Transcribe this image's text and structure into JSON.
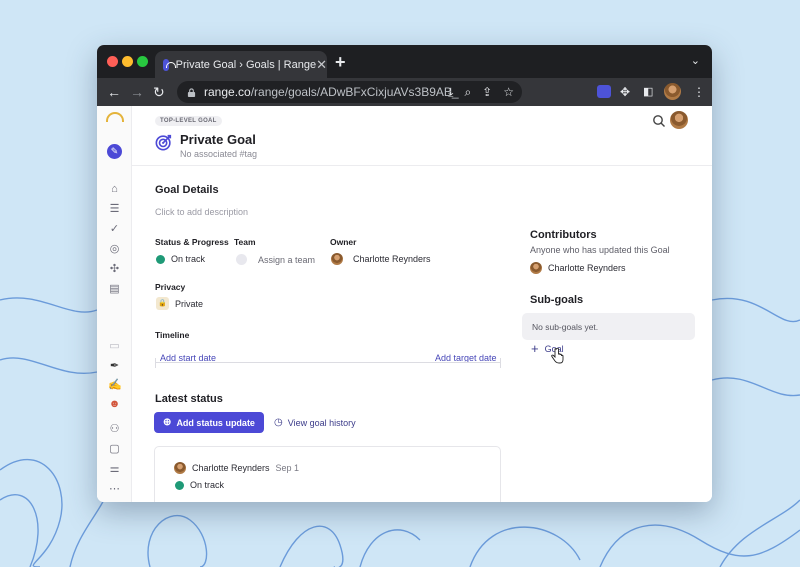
{
  "browser": {
    "tab_title": "Private Goal › Goals | Range",
    "tab_close": "✕",
    "new_tab": "+",
    "tabs_menu": "⌄",
    "url_host": "range.co",
    "url_path": "/range/goals/ADwBFxCixjuAVs3B9AB_",
    "back_icon": "←",
    "forward_icon": "→",
    "reload_icon": "↻"
  },
  "header": {
    "badge": "TOP-LEVEL GOAL",
    "title": "Private Goal",
    "tag": "No associated #tag"
  },
  "details": {
    "title": "Goal Details",
    "description_placeholder": "Click to add description",
    "status_label": "Status & Progress",
    "status_value": "On track",
    "team_label": "Team",
    "team_value": "Assign a team",
    "owner_label": "Owner",
    "owner_value": "Charlotte Reynders",
    "privacy_label": "Privacy",
    "privacy_value": "Private",
    "timeline_label": "Timeline",
    "start_date": "Add start date",
    "target_date": "Add target date"
  },
  "latest_status": {
    "title": "Latest status",
    "add_button": "Add status update",
    "history_link": "View goal history",
    "card_author": "Charlotte Reynders",
    "card_date": "Sep 1",
    "card_status": "On track"
  },
  "contributors": {
    "title": "Contributors",
    "subtitle": "Anyone who has updated this Goal",
    "person": "Charlotte Reynders"
  },
  "subgoals": {
    "title": "Sub-goals",
    "empty": "No sub-goals yet.",
    "add_label": "Goal"
  },
  "colors": {
    "accent": "#4c49d6",
    "status_green": "#1f9a77",
    "tab_bg": "#1e1f22",
    "toolbar_bg": "#35363a"
  }
}
